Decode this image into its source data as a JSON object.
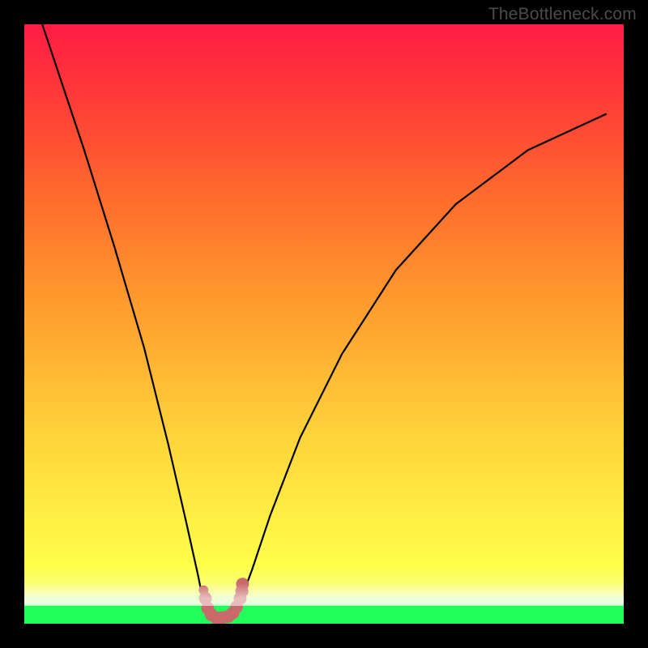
{
  "watermark": {
    "text": "TheBottleneck.com"
  },
  "chart_data": {
    "type": "line",
    "title": "",
    "xlabel": "",
    "ylabel": "",
    "xlim": [
      0,
      100
    ],
    "ylim": [
      0,
      100
    ],
    "grid": false,
    "legend": false,
    "series": [
      {
        "name": "bottleneck-curve",
        "stroke": "#000000",
        "stroke_width": 2.2,
        "x": [
          3,
          10,
          15,
          20,
          24,
          27,
          29,
          30,
          31,
          32,
          33,
          35,
          36.5,
          38,
          41,
          46,
          53,
          62,
          72,
          84,
          97
        ],
        "values": [
          100,
          79,
          63,
          46,
          30,
          17,
          8,
          3,
          1,
          1,
          1,
          2,
          5,
          9,
          18,
          31,
          45,
          59,
          70,
          79,
          85
        ]
      },
      {
        "name": "marker-dots",
        "stroke": "#c96a6a",
        "type_hint": "marker-trail",
        "x": [
          30.2,
          30.6,
          31.2,
          32.0,
          33.0,
          34.0,
          34.8,
          35.4,
          36.0,
          36.3,
          36.4
        ],
        "values": [
          4.2,
          2.6,
          1.5,
          1.0,
          1.0,
          1.2,
          1.8,
          2.8,
          4.2,
          5.4,
          6.6
        ],
        "dot_radius": 8
      }
    ],
    "background": {
      "gradient_stops": [
        {
          "pos": 0.0,
          "color": "#21ff5a"
        },
        {
          "pos": 0.03,
          "color": "#21ff5a"
        },
        {
          "pos": 0.05,
          "color": "#f7ff8a"
        },
        {
          "pos": 0.1,
          "color": "#ffff4a"
        },
        {
          "pos": 0.31,
          "color": "#ffd43a"
        },
        {
          "pos": 0.54,
          "color": "#ff9a2d"
        },
        {
          "pos": 0.71,
          "color": "#ff6a2d"
        },
        {
          "pos": 0.88,
          "color": "#ff3a38"
        },
        {
          "pos": 1.0,
          "color": "#ff1d44"
        }
      ]
    }
  }
}
